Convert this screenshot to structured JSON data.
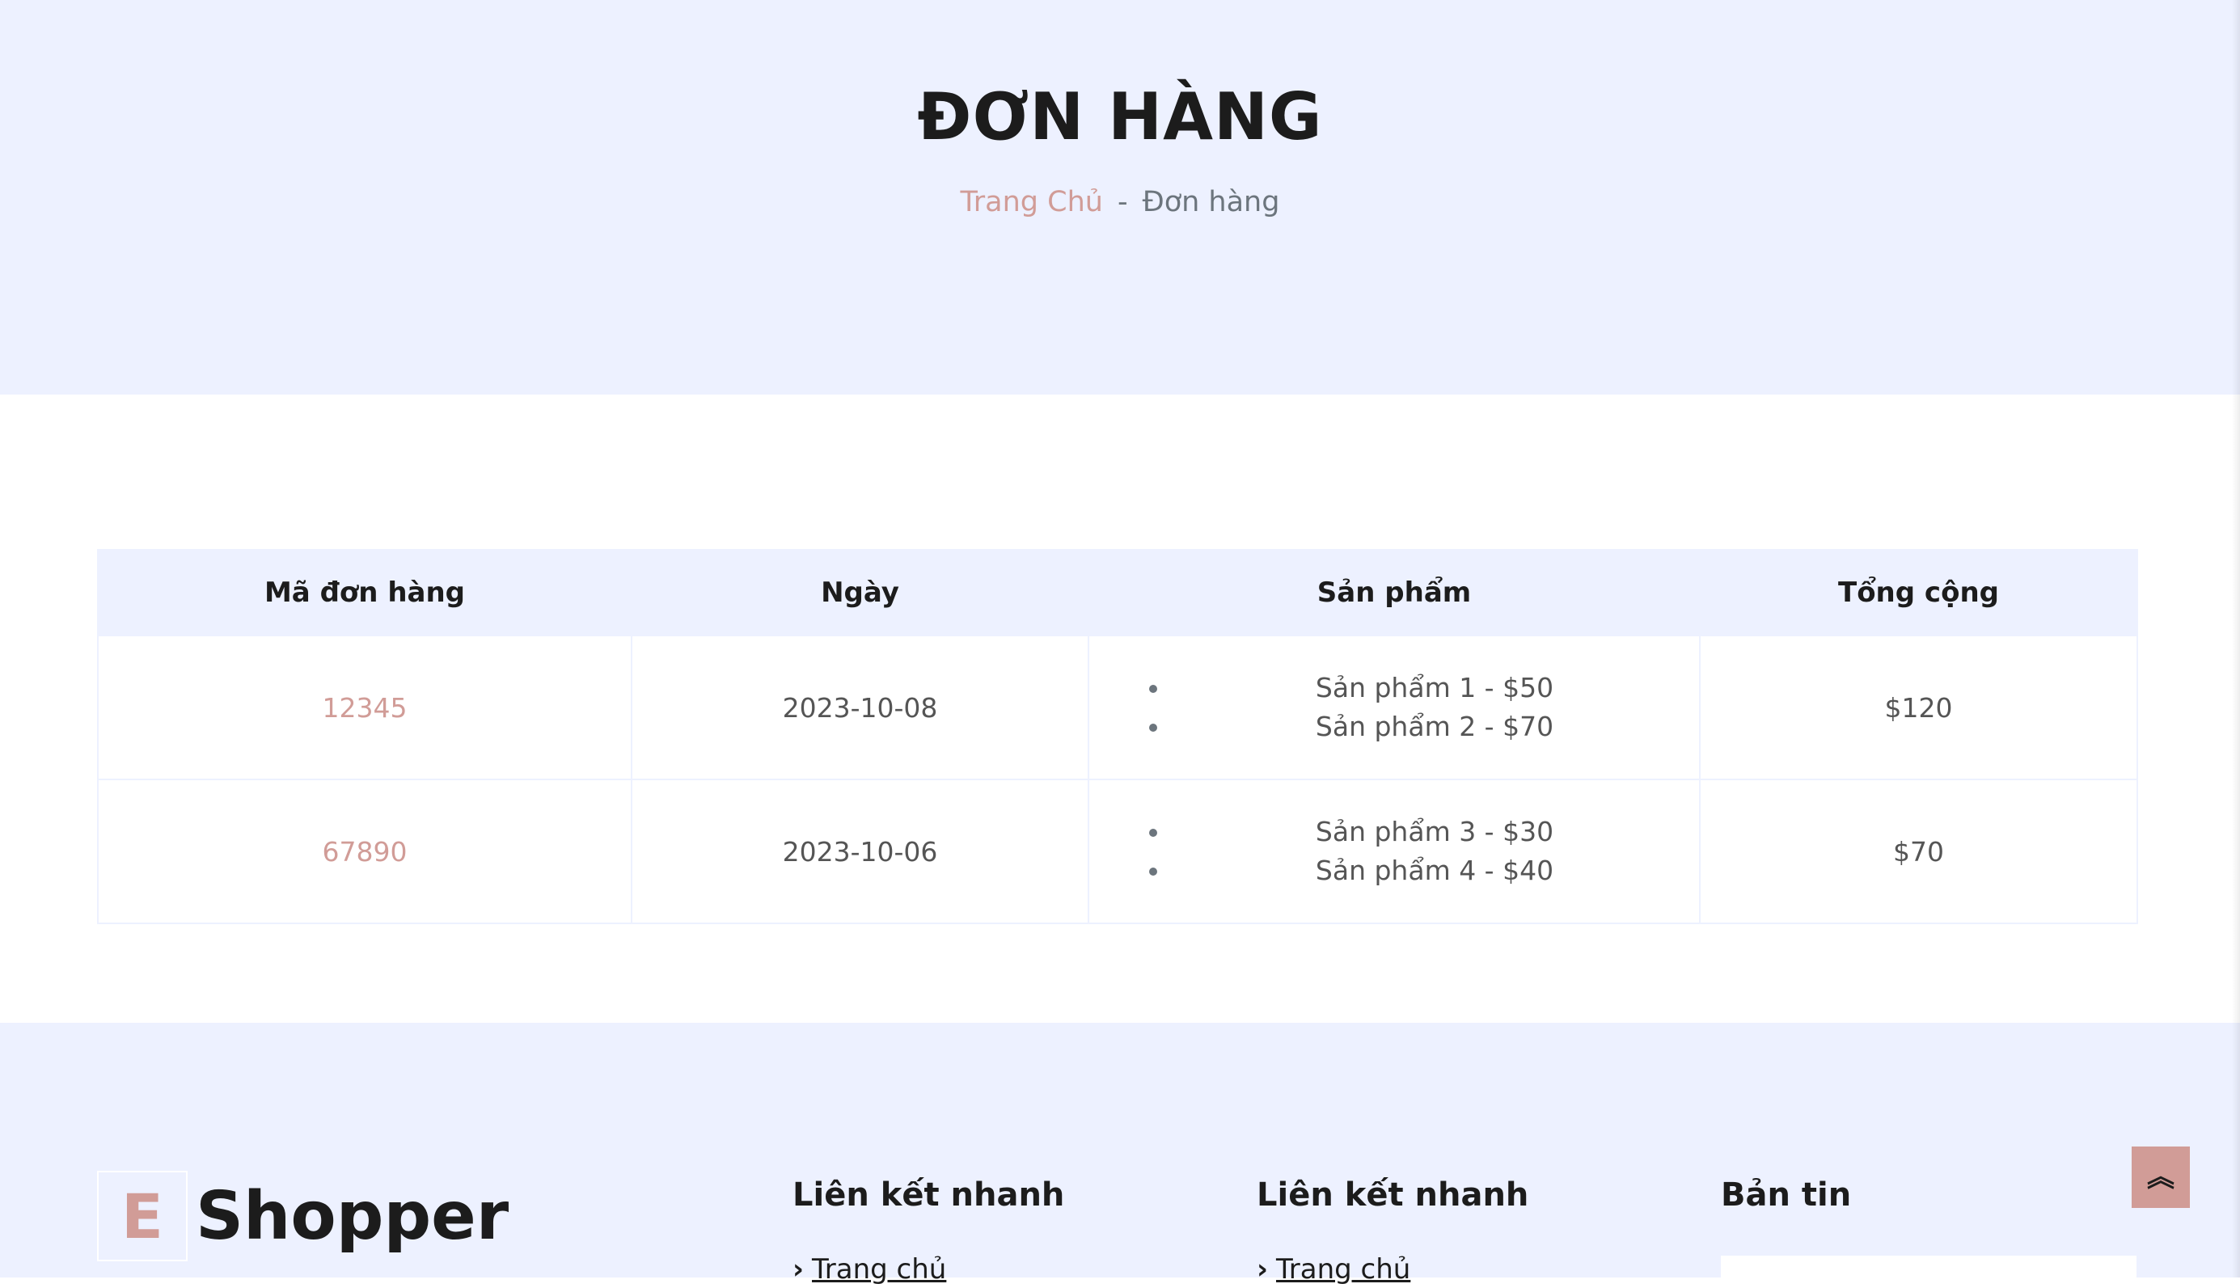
{
  "header": {
    "title": "ĐƠN HÀNG",
    "breadcrumb": {
      "home": "Trang Chủ",
      "separator": "-",
      "current": "Đơn hàng"
    }
  },
  "table": {
    "headers": [
      "Mã đơn hàng",
      "Ngày",
      "Sản phẩm",
      "Tổng cộng"
    ],
    "rows": [
      {
        "order_id": "12345",
        "date": "2023-10-08",
        "products": [
          "Sản phẩm 1 - $50",
          "Sản phẩm 2 - $70"
        ],
        "total": "$120"
      },
      {
        "order_id": "67890",
        "date": "2023-10-06",
        "products": [
          "Sản phẩm 3 - $30",
          "Sản phẩm 4 - $40"
        ],
        "total": "$70"
      }
    ]
  },
  "footer": {
    "brand": {
      "letter": "E",
      "name": "Shopper"
    },
    "columns": [
      {
        "title": "Liên kết nhanh",
        "first_link": "Trang chủ"
      },
      {
        "title": "Liên kết nhanh",
        "first_link": "Trang chủ"
      },
      {
        "title": "Bản tin"
      }
    ]
  },
  "back_to_top_icon": "double-chevron-up-icon",
  "colors": {
    "accent": "#d19c97",
    "header_bg": "#edf1ff",
    "text_dark": "#1c1c1c"
  }
}
